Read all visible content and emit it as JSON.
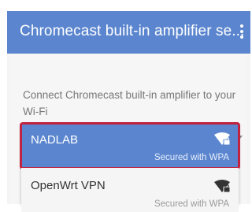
{
  "appbar": {
    "title": "Chromecast built-in amplifier se...",
    "menu_icon": "more-vert-icon"
  },
  "prompt": "Connect Chromecast built-in amplifier to your Wi-Fi",
  "networks": [
    {
      "name": "NADLAB",
      "security": "Secured with WPA",
      "icon": "wifi-lock-icon",
      "selected": true
    },
    {
      "name": "OpenWrt VPN",
      "security": "Secured with WPA",
      "icon": "wifi-lock-icon",
      "selected": false
    }
  ],
  "colors": {
    "accent": "#5b86cf",
    "selection_outline": "#c0223f"
  }
}
